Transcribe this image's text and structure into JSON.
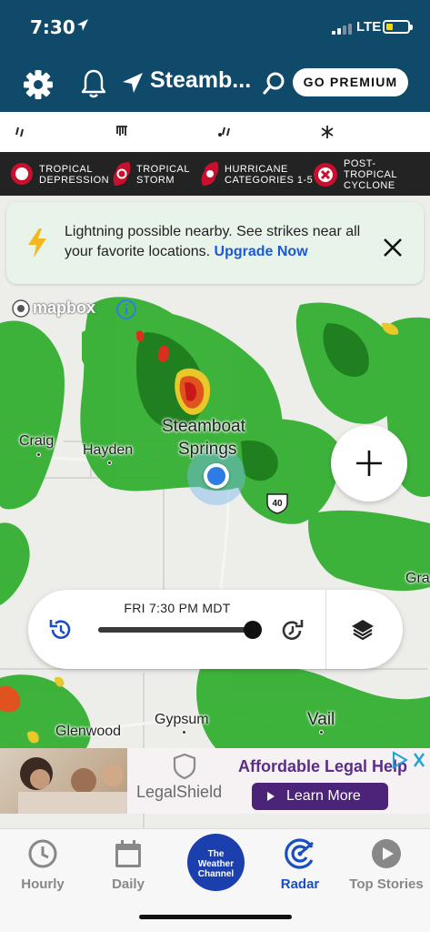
{
  "status_bar": {
    "time": "7:30",
    "network": "LTE"
  },
  "header": {
    "location": "Steamb...",
    "premium_label": "GO PREMIUM",
    "colors": {
      "background": "#0f4a6b"
    }
  },
  "storm_legend": [
    {
      "label_line1": "TROPICAL",
      "label_line2": "DEPRESSION"
    },
    {
      "label_line1": "TROPICAL",
      "label_line2": "STORM"
    },
    {
      "label_line1": "HURRICANE",
      "label_line2": "CATEGORIES 1-5"
    },
    {
      "label_line1": "POST-",
      "label_line2": "TROPICAL",
      "label_line3": "CYCLONE"
    }
  ],
  "banner": {
    "message": "Lightning possible nearby. See strikes near all your favorite locations.",
    "link": "Upgrade Now"
  },
  "map": {
    "attribution": "mapbox",
    "cities": {
      "craig": "Craig",
      "hayden": "Hayden",
      "steamboat_line1": "Steamboat",
      "steamboat_line2": "Springs",
      "gypsum": "Gypsum",
      "vail": "Vail",
      "glenwood": "Glenwood",
      "gra": "Gra"
    },
    "route_shield": "40"
  },
  "timeline": {
    "time": "FRI 7:30 PM MDT",
    "progress": 1.0
  },
  "ad": {
    "brand": "LegalShield",
    "headline": "Affordable Legal Help",
    "cta": "Learn More"
  },
  "tabs": [
    {
      "label": "Hourly",
      "active": false
    },
    {
      "label": "Daily",
      "active": false
    },
    {
      "label_line1": "The",
      "label_line2": "Weather",
      "label_line3": "Channel"
    },
    {
      "label": "Radar",
      "active": true
    },
    {
      "label": "Top Stories",
      "active": false
    }
  ],
  "colors": {
    "active_tab": "#1a4fc4",
    "inactive_tab": "#888888",
    "radar_green": "#2ea82a",
    "location_dot": "#2f7ce6"
  }
}
